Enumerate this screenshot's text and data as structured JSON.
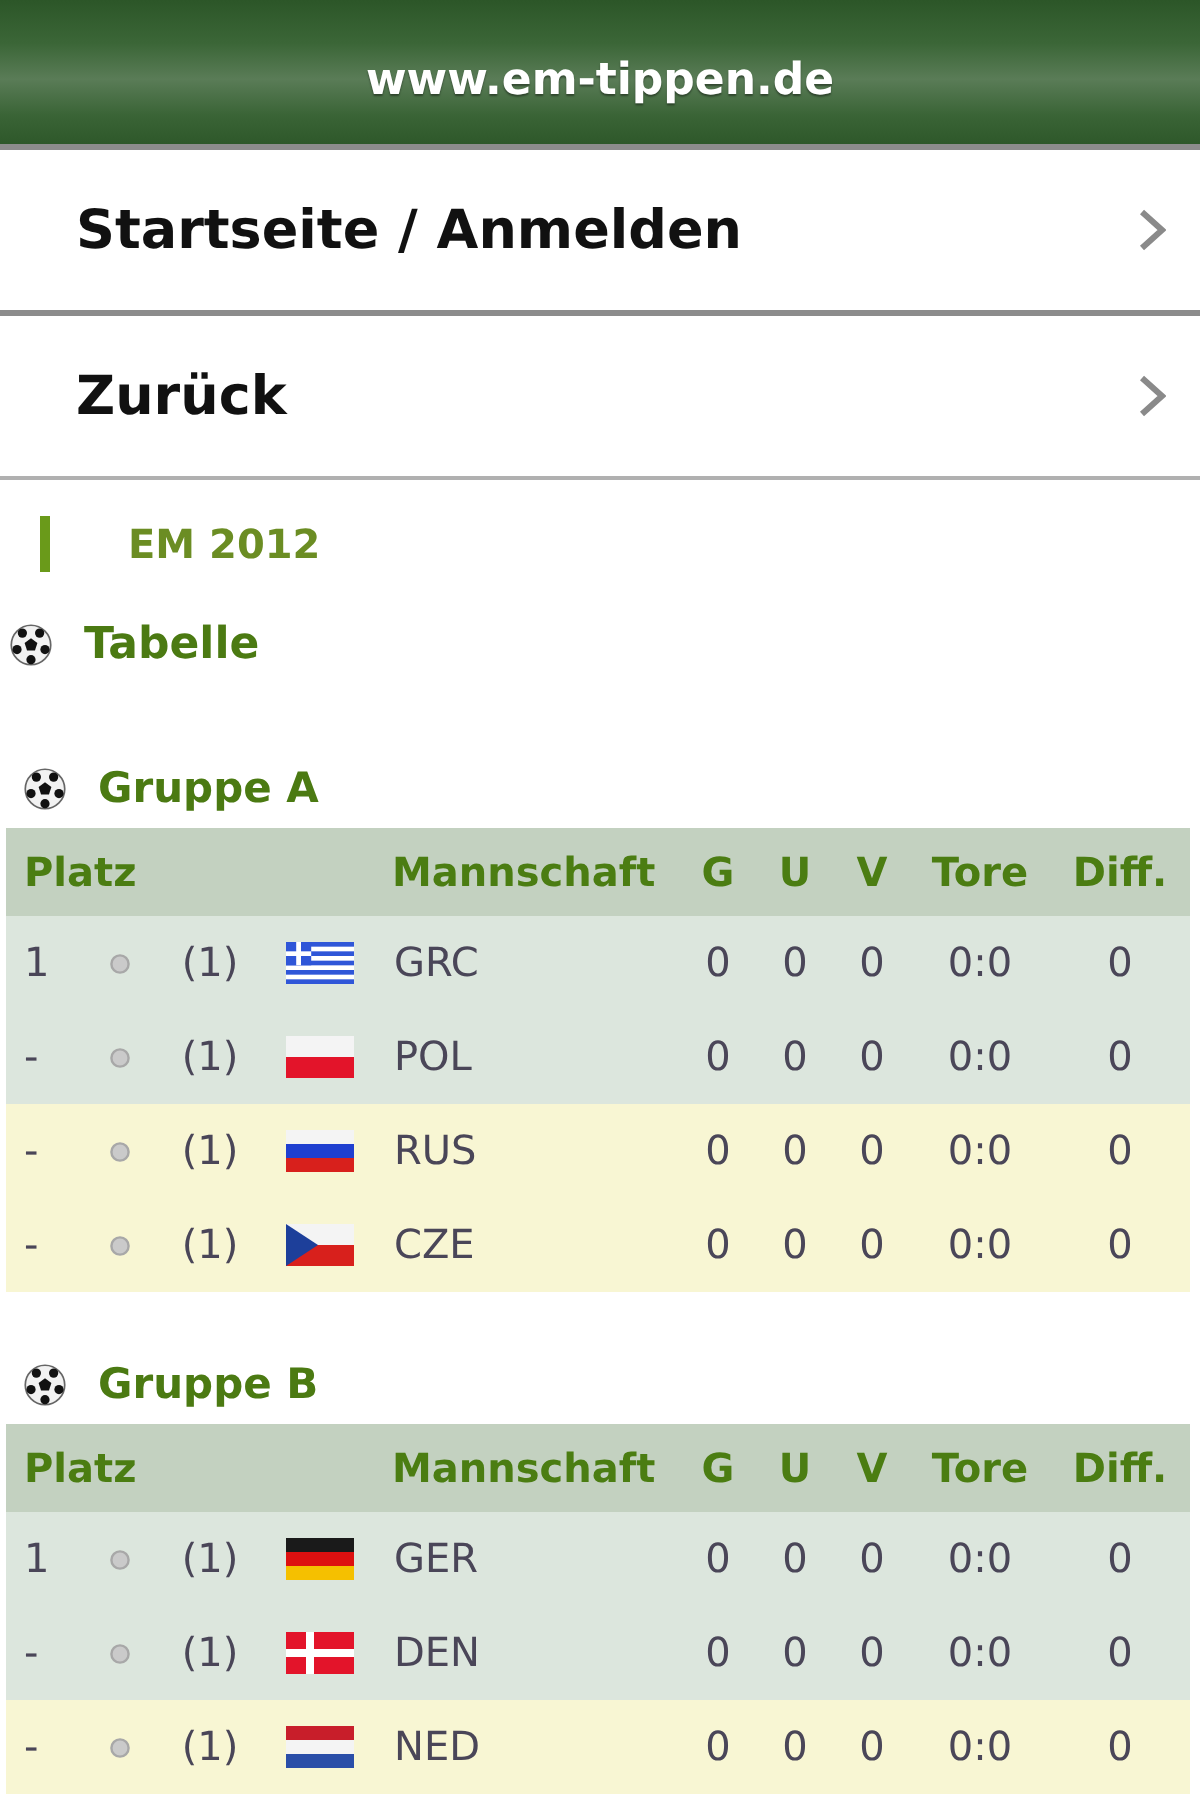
{
  "header": {
    "title": "www.em-tippen.de"
  },
  "nav": [
    {
      "label": "Startseite / Anmelden"
    },
    {
      "label": "Zurück"
    }
  ],
  "section": {
    "title": "EM 2012"
  },
  "page_title": "Tabelle",
  "groups": [
    {
      "title": "Gruppe A",
      "columns": [
        "Platz",
        "Mannschaft",
        "G",
        "U",
        "V",
        "Tore",
        "Diff."
      ],
      "rows": [
        {
          "platz": "1",
          "previous": "(1)",
          "flag": {
            "kind": "grc"
          },
          "team": "GRC",
          "g": "0",
          "u": "0",
          "v": "0",
          "tore": "0:0",
          "diff": "0",
          "qualifies": true
        },
        {
          "platz": "-",
          "previous": "(1)",
          "flag": {
            "kind": "pol"
          },
          "team": "POL",
          "g": "0",
          "u": "0",
          "v": "0",
          "tore": "0:0",
          "diff": "0",
          "qualifies": true
        },
        {
          "platz": "-",
          "previous": "(1)",
          "flag": {
            "kind": "rus"
          },
          "team": "RUS",
          "g": "0",
          "u": "0",
          "v": "0",
          "tore": "0:0",
          "diff": "0",
          "qualifies": false
        },
        {
          "platz": "-",
          "previous": "(1)",
          "flag": {
            "kind": "cze"
          },
          "team": "CZE",
          "g": "0",
          "u": "0",
          "v": "0",
          "tore": "0:0",
          "diff": "0",
          "qualifies": false
        }
      ]
    },
    {
      "title": "Gruppe B",
      "columns": [
        "Platz",
        "Mannschaft",
        "G",
        "U",
        "V",
        "Tore",
        "Diff."
      ],
      "rows": [
        {
          "platz": "1",
          "previous": "(1)",
          "flag": {
            "kind": "ger"
          },
          "team": "GER",
          "g": "0",
          "u": "0",
          "v": "0",
          "tore": "0:0",
          "diff": "0",
          "qualifies": true
        },
        {
          "platz": "-",
          "previous": "(1)",
          "flag": {
            "kind": "den"
          },
          "team": "DEN",
          "g": "0",
          "u": "0",
          "v": "0",
          "tore": "0:0",
          "diff": "0",
          "qualifies": true
        },
        {
          "platz": "-",
          "previous": "(1)",
          "flag": {
            "kind": "ned"
          },
          "team": "NED",
          "g": "0",
          "u": "0",
          "v": "0",
          "tore": "0:0",
          "diff": "0",
          "qualifies": false
        }
      ]
    }
  ]
}
